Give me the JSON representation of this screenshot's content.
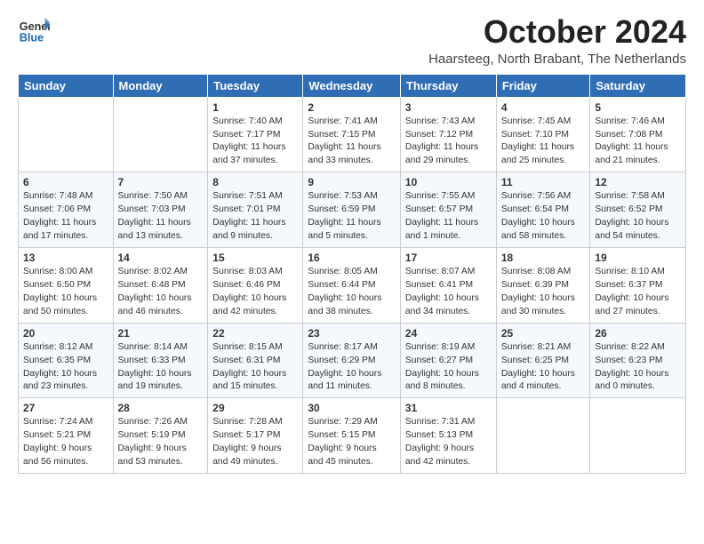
{
  "logo": {
    "line1": "General",
    "line2": "Blue"
  },
  "title": "October 2024",
  "location": "Haarsteeg, North Brabant, The Netherlands",
  "headers": [
    "Sunday",
    "Monday",
    "Tuesday",
    "Wednesday",
    "Thursday",
    "Friday",
    "Saturday"
  ],
  "weeks": [
    [
      {
        "day": "",
        "content": ""
      },
      {
        "day": "",
        "content": ""
      },
      {
        "day": "1",
        "content": "Sunrise: 7:40 AM\nSunset: 7:17 PM\nDaylight: 11 hours\nand 37 minutes."
      },
      {
        "day": "2",
        "content": "Sunrise: 7:41 AM\nSunset: 7:15 PM\nDaylight: 11 hours\nand 33 minutes."
      },
      {
        "day": "3",
        "content": "Sunrise: 7:43 AM\nSunset: 7:12 PM\nDaylight: 11 hours\nand 29 minutes."
      },
      {
        "day": "4",
        "content": "Sunrise: 7:45 AM\nSunset: 7:10 PM\nDaylight: 11 hours\nand 25 minutes."
      },
      {
        "day": "5",
        "content": "Sunrise: 7:46 AM\nSunset: 7:08 PM\nDaylight: 11 hours\nand 21 minutes."
      }
    ],
    [
      {
        "day": "6",
        "content": "Sunrise: 7:48 AM\nSunset: 7:06 PM\nDaylight: 11 hours\nand 17 minutes."
      },
      {
        "day": "7",
        "content": "Sunrise: 7:50 AM\nSunset: 7:03 PM\nDaylight: 11 hours\nand 13 minutes."
      },
      {
        "day": "8",
        "content": "Sunrise: 7:51 AM\nSunset: 7:01 PM\nDaylight: 11 hours\nand 9 minutes."
      },
      {
        "day": "9",
        "content": "Sunrise: 7:53 AM\nSunset: 6:59 PM\nDaylight: 11 hours\nand 5 minutes."
      },
      {
        "day": "10",
        "content": "Sunrise: 7:55 AM\nSunset: 6:57 PM\nDaylight: 11 hours\nand 1 minute."
      },
      {
        "day": "11",
        "content": "Sunrise: 7:56 AM\nSunset: 6:54 PM\nDaylight: 10 hours\nand 58 minutes."
      },
      {
        "day": "12",
        "content": "Sunrise: 7:58 AM\nSunset: 6:52 PM\nDaylight: 10 hours\nand 54 minutes."
      }
    ],
    [
      {
        "day": "13",
        "content": "Sunrise: 8:00 AM\nSunset: 6:50 PM\nDaylight: 10 hours\nand 50 minutes."
      },
      {
        "day": "14",
        "content": "Sunrise: 8:02 AM\nSunset: 6:48 PM\nDaylight: 10 hours\nand 46 minutes."
      },
      {
        "day": "15",
        "content": "Sunrise: 8:03 AM\nSunset: 6:46 PM\nDaylight: 10 hours\nand 42 minutes."
      },
      {
        "day": "16",
        "content": "Sunrise: 8:05 AM\nSunset: 6:44 PM\nDaylight: 10 hours\nand 38 minutes."
      },
      {
        "day": "17",
        "content": "Sunrise: 8:07 AM\nSunset: 6:41 PM\nDaylight: 10 hours\nand 34 minutes."
      },
      {
        "day": "18",
        "content": "Sunrise: 8:08 AM\nSunset: 6:39 PM\nDaylight: 10 hours\nand 30 minutes."
      },
      {
        "day": "19",
        "content": "Sunrise: 8:10 AM\nSunset: 6:37 PM\nDaylight: 10 hours\nand 27 minutes."
      }
    ],
    [
      {
        "day": "20",
        "content": "Sunrise: 8:12 AM\nSunset: 6:35 PM\nDaylight: 10 hours\nand 23 minutes."
      },
      {
        "day": "21",
        "content": "Sunrise: 8:14 AM\nSunset: 6:33 PM\nDaylight: 10 hours\nand 19 minutes."
      },
      {
        "day": "22",
        "content": "Sunrise: 8:15 AM\nSunset: 6:31 PM\nDaylight: 10 hours\nand 15 minutes."
      },
      {
        "day": "23",
        "content": "Sunrise: 8:17 AM\nSunset: 6:29 PM\nDaylight: 10 hours\nand 11 minutes."
      },
      {
        "day": "24",
        "content": "Sunrise: 8:19 AM\nSunset: 6:27 PM\nDaylight: 10 hours\nand 8 minutes."
      },
      {
        "day": "25",
        "content": "Sunrise: 8:21 AM\nSunset: 6:25 PM\nDaylight: 10 hours\nand 4 minutes."
      },
      {
        "day": "26",
        "content": "Sunrise: 8:22 AM\nSunset: 6:23 PM\nDaylight: 10 hours\nand 0 minutes."
      }
    ],
    [
      {
        "day": "27",
        "content": "Sunrise: 7:24 AM\nSunset: 5:21 PM\nDaylight: 9 hours\nand 56 minutes."
      },
      {
        "day": "28",
        "content": "Sunrise: 7:26 AM\nSunset: 5:19 PM\nDaylight: 9 hours\nand 53 minutes."
      },
      {
        "day": "29",
        "content": "Sunrise: 7:28 AM\nSunset: 5:17 PM\nDaylight: 9 hours\nand 49 minutes."
      },
      {
        "day": "30",
        "content": "Sunrise: 7:29 AM\nSunset: 5:15 PM\nDaylight: 9 hours\nand 45 minutes."
      },
      {
        "day": "31",
        "content": "Sunrise: 7:31 AM\nSunset: 5:13 PM\nDaylight: 9 hours\nand 42 minutes."
      },
      {
        "day": "",
        "content": ""
      },
      {
        "day": "",
        "content": ""
      }
    ]
  ]
}
